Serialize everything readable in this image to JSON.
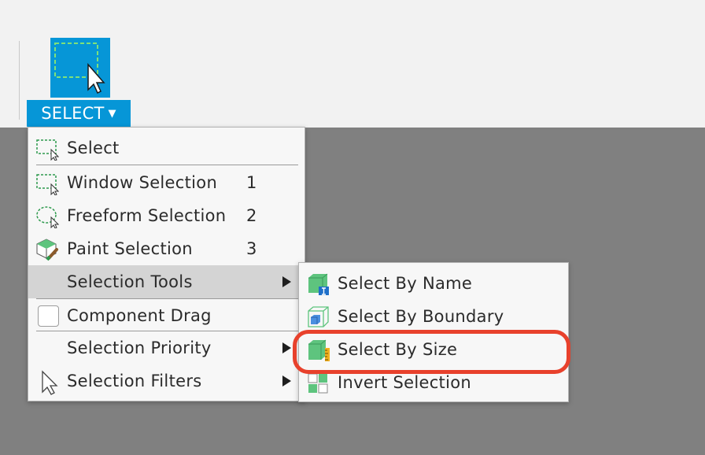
{
  "toolbar": {
    "select_label": "SELECT",
    "select_icon": "select-dashed-box-icon",
    "accent_color": "#0696d7"
  },
  "menu": {
    "items": [
      {
        "label": "Select",
        "icon": "select-icon"
      },
      {
        "label": "Window Selection",
        "shortcut": "1",
        "icon": "window-selection-icon"
      },
      {
        "label": "Freeform Selection",
        "shortcut": "2",
        "icon": "freeform-selection-icon"
      },
      {
        "label": "Paint Selection",
        "shortcut": "3",
        "icon": "paint-selection-icon"
      },
      {
        "label": "Selection Tools",
        "icon": "submenu-arrow",
        "state": "highlighted"
      },
      {
        "label": "Component Drag",
        "icon": "checkbox"
      },
      {
        "label": "Selection Priority",
        "icon": "submenu-arrow"
      },
      {
        "label": "Selection Filters",
        "icon": "cursor-arrow-icon"
      }
    ]
  },
  "submenu": {
    "items": [
      {
        "label": "Select By Name",
        "icon": "select-by-name-icon"
      },
      {
        "label": "Select By Boundary",
        "icon": "select-by-boundary-icon"
      },
      {
        "label": "Select By Size",
        "icon": "select-by-size-icon",
        "state": "circled"
      },
      {
        "label": "Invert Selection",
        "icon": "invert-selection-icon"
      }
    ]
  },
  "colors": {
    "highlight_ring": "#e8412c",
    "cube_green": "#5ec47e"
  }
}
